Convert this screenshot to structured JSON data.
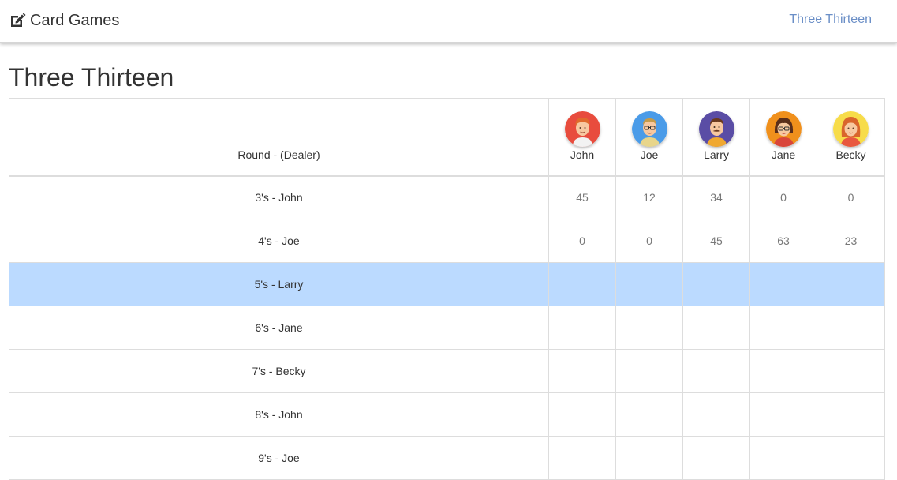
{
  "navbar": {
    "brand_label": "Card Games",
    "brand_icon": "edit-icon",
    "link_label": "Three Thirteen",
    "link_color": "#6b8fc7"
  },
  "page": {
    "title": "Three Thirteen"
  },
  "table": {
    "round_header": "Round - (Dealer)",
    "highlight_color": "#bbdaff",
    "players": [
      {
        "name": "John",
        "avatar_icon": "redhead-man-avatar-icon",
        "avatar_bg": "#e84c3d"
      },
      {
        "name": "Joe",
        "avatar_icon": "glasses-man-avatar-icon",
        "avatar_bg": "#4a9be8"
      },
      {
        "name": "Larry",
        "avatar_icon": "mustache-man-avatar-icon",
        "avatar_bg": "#5a4da5"
      },
      {
        "name": "Jane",
        "avatar_icon": "glasses-woman-avatar-icon",
        "avatar_bg": "#f0901c"
      },
      {
        "name": "Becky",
        "avatar_icon": "redhead-woman-avatar-icon",
        "avatar_bg": "#f7dc4a"
      }
    ],
    "rounds": [
      {
        "label": "3's - John",
        "scores": [
          "45",
          "12",
          "34",
          "0",
          "0"
        ],
        "active": false
      },
      {
        "label": "4's - Joe",
        "scores": [
          "0",
          "0",
          "45",
          "63",
          "23"
        ],
        "active": false
      },
      {
        "label": "5's - Larry",
        "scores": [
          "",
          "",
          "",
          "",
          ""
        ],
        "active": true
      },
      {
        "label": "6's - Jane",
        "scores": [
          "",
          "",
          "",
          "",
          ""
        ],
        "active": false
      },
      {
        "label": "7's - Becky",
        "scores": [
          "",
          "",
          "",
          "",
          ""
        ],
        "active": false
      },
      {
        "label": "8's - John",
        "scores": [
          "",
          "",
          "",
          "",
          ""
        ],
        "active": false
      },
      {
        "label": "9's - Joe",
        "scores": [
          "",
          "",
          "",
          "",
          ""
        ],
        "active": false
      }
    ]
  }
}
